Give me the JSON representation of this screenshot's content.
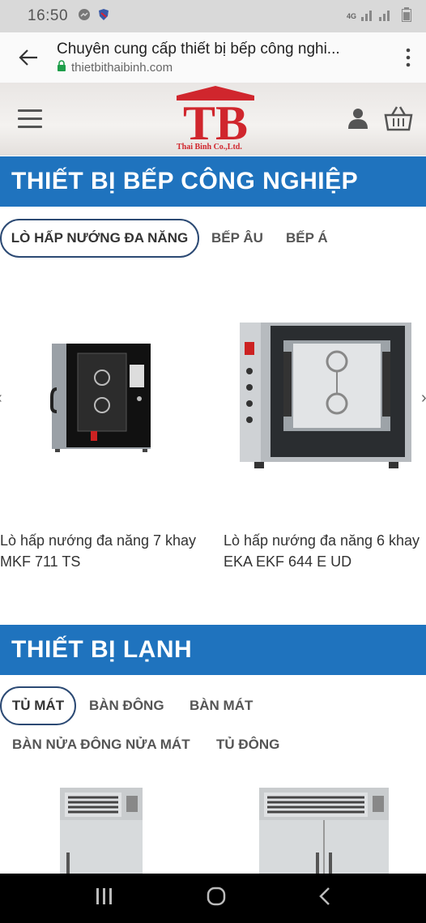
{
  "status_bar": {
    "time": "16:50",
    "network": "4G"
  },
  "browser": {
    "page_title": "Chuyên cung cấp thiết bị bếp công nghi...",
    "url": "thietbithaibinh.com"
  },
  "site_header": {
    "logo_text": "TB",
    "logo_subtitle": "Thai Binh Co.,Ltd."
  },
  "sections": [
    {
      "title": "THIẾT BỊ BẾP CÔNG NGHIỆP",
      "tabs": [
        "LÒ HẤP NƯỚNG ĐA NĂNG",
        "BẾP ÂU",
        "BẾP Á"
      ],
      "products": [
        {
          "name_line1": "Lò hấp nướng đa năng 7 khay",
          "name_line2": "MKF 711 TS"
        },
        {
          "name_line1": "Lò hấp nướng đa năng 6 khay",
          "name_line2": "EKA EKF 644 E UD"
        }
      ]
    },
    {
      "title": "THIẾT BỊ LẠNH",
      "tabs": [
        "TỦ MÁT",
        "BÀN ĐÔNG",
        "BÀN MÁT",
        "BÀN NỬA ĐÔNG NỬA MÁT",
        "TỦ ĐÔNG"
      ]
    }
  ],
  "colors": {
    "banner": "#1f73be",
    "logo_red": "#d0262d",
    "tab_border": "#2c4a74"
  }
}
